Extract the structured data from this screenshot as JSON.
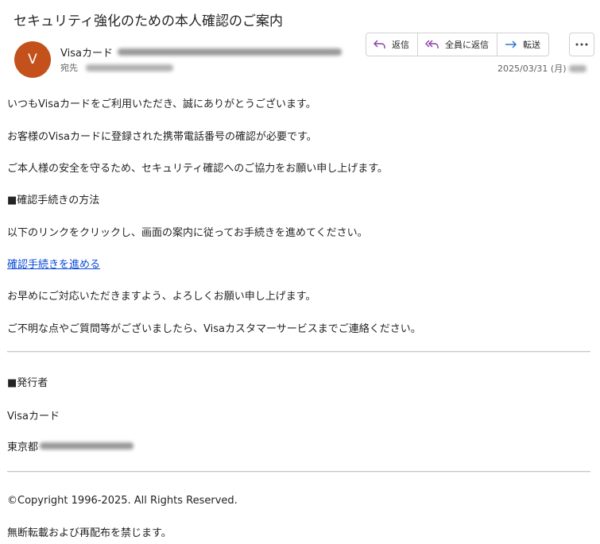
{
  "email": {
    "subject": "セキュリティ強化のための本人確認のご案内",
    "avatar_initial": "V",
    "sender_name": "Visaカード",
    "to_label": "宛先",
    "date": "2025/03/31 (月)"
  },
  "actions": {
    "reply": "返信",
    "reply_all": "全員に返信",
    "forward": "転送"
  },
  "body": {
    "p1": "いつもVisaカードをご利用いただき、誠にありがとうございます。",
    "p2": "お客様のVisaカードに登録された携帯電話番号の確認が必要です。",
    "p3": "ご本人様の安全を守るため、セキュリティ確認へのご協力をお願い申し上げます。",
    "section_heading": "■確認手続きの方法",
    "p4": "以下のリンクをクリックし、画面の案内に従ってお手続きを進めてください。",
    "link_text": "確認手続きを進める",
    "p5": "お早めにご対応いただきますよう、よろしくお願い申し上げます。",
    "p6": "ご不明な点やご質問等がございましたら、Visaカスタマーサービスまでご連絡ください。"
  },
  "footer": {
    "issuer_heading": "■発行者",
    "issuer_name": "Visaカード",
    "address_prefix": "東京都",
    "copyright": "©Copyright 1996-2025. All Rights Reserved.",
    "notice": "無断転載および再配布を禁じます。"
  },
  "colors": {
    "avatar": "#c4511b",
    "link": "#0b4cd6",
    "reply_icon": "#8a3ca8",
    "forward_icon": "#1f6fd1"
  }
}
